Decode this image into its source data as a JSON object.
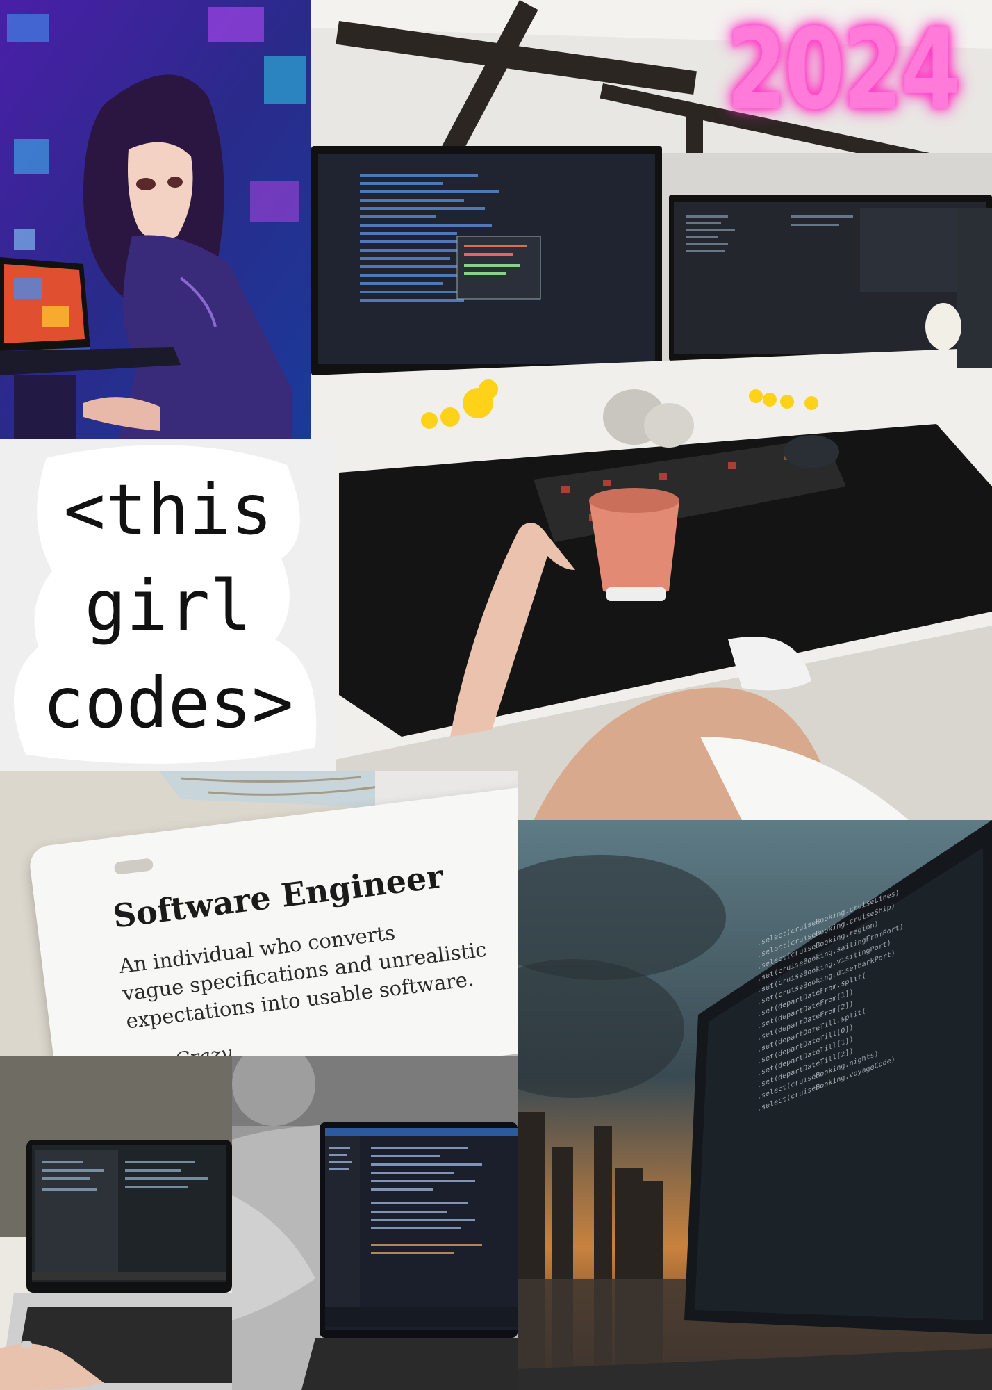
{
  "collage": {
    "year": "2024",
    "sticker": {
      "line1": "<this",
      "line2": "girl",
      "line3": "codes>"
    },
    "card": {
      "title": "Software Engineer",
      "definition_line1": "An individual who converts",
      "definition_line2": "vague specifications and unrealistic",
      "definition_line3": "expectations into usable software.",
      "signature": "See Crazy."
    },
    "city_code_snippets": [
      ".select(cruiseBooking.cruiseLines)",
      ".select(cruiseBooking.cruiseShip)",
      ".select(cruiseBooking.region)",
      ".set(cruiseBooking.sailingFromPort)",
      ".set(cruiseBooking.visitingPort)",
      ".set(cruiseBooking.disembarkPort)",
      ".set(departDateFrom.split(",
      ".set(departDateFrom[1])",
      ".set(departDateFrom[2])",
      ".set(departDateTill.split(",
      ".set(departDateTill[0])",
      ".set(departDateTill[1])",
      ".set(departDateTill[2])",
      ".select(cruiseBooking.nights)",
      ".select(cruiseBooking.voyageCode)"
    ]
  }
}
